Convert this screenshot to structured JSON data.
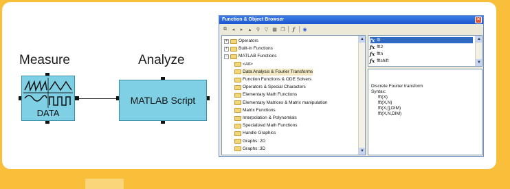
{
  "diagram": {
    "measure_label": "Measure",
    "analyze_label": "Analyze",
    "data_block_label": "DATA",
    "matlab_block_label": "MATLAB Script"
  },
  "browser": {
    "title": "Function & Object Browser",
    "toolbar_icons": [
      "hierarchy-icon",
      "back-icon",
      "forward-icon",
      "up-icon",
      "pin-icon",
      "filter-icon",
      "grid-icon",
      "copy-icon",
      "function-icon",
      "help-icon"
    ],
    "tree": {
      "items": [
        {
          "label": "Operators",
          "expander": "+"
        },
        {
          "label": "Built-in Functions",
          "expander": "+"
        },
        {
          "label": "MATLAB Functions",
          "expander": "−"
        },
        {
          "label": "<All>"
        },
        {
          "label": "Data Analysis & Fourier Transforms",
          "selected": true
        },
        {
          "label": "Function Functions & ODE Solvers"
        },
        {
          "label": "Operators & Special Characters"
        },
        {
          "label": "Elementary Math Functions"
        },
        {
          "label": "Elementary Matrices & Matrix manipulation"
        },
        {
          "label": "Matrix Functions"
        },
        {
          "label": "Interpolation & Polynomials"
        },
        {
          "label": "Specialized Math Functions"
        },
        {
          "label": "Handle Graphics"
        },
        {
          "label": "Graphs: 2D"
        },
        {
          "label": "Graphs: 3D"
        }
      ]
    },
    "functions": {
      "items": [
        {
          "label": "fft",
          "selected": true
        },
        {
          "label": "fft2"
        },
        {
          "label": "fftn"
        },
        {
          "label": "fftshift"
        }
      ]
    },
    "help": {
      "description": "Discrete Fourier transform",
      "syntax_label": "Syntax:",
      "syntax_lines": [
        "fft(X)",
        "fft(X,N)",
        "fft(X,[],DIM)",
        "fft(X,N,DIM)"
      ]
    }
  },
  "colors": {
    "background": "#f9bf3b",
    "block_fill": "#7fd0e4",
    "titlebar": "#1c56cf",
    "selection": "#316ac5"
  }
}
